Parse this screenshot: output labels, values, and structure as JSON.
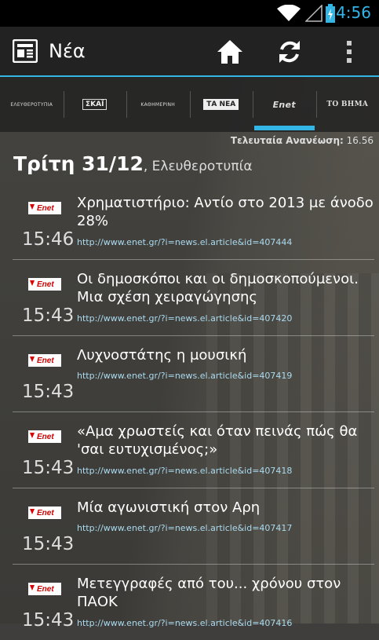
{
  "status_bar": {
    "time": "4:56"
  },
  "action_bar": {
    "title": "Νέα",
    "icons": [
      "newspaper-icon",
      "home-icon",
      "refresh-icon",
      "overflow-menu-icon"
    ]
  },
  "tabs": [
    {
      "label": "ΕΛΕΥΘΕΡΟΤΥΠΙΑ",
      "selected": false
    },
    {
      "label": "ΣΚΑΪ",
      "selected": false
    },
    {
      "label": "ΚΑΘΗΜΕΡΙΝΗ",
      "selected": false
    },
    {
      "label": "ΤΑ ΝΕΑ",
      "selected": false
    },
    {
      "label": "Enet",
      "selected": true
    },
    {
      "label": "ΤΟ ΒΗΜΑ",
      "selected": false
    }
  ],
  "last_update": {
    "label": "Τελευταία Ανανέωση:",
    "value": "16.56"
  },
  "date_header": {
    "day": "Τρίτη 31/12",
    "paper": ", Ελευθεροτυπία"
  },
  "source_logo_text": "Enet",
  "articles": [
    {
      "time": "15:46",
      "title": "Χρηματιστήριο: Αντίο στο 2013 με άνοδο 28%",
      "url": "http://www.enet.gr/?i=news.el.article&id=407444"
    },
    {
      "time": "15:43",
      "title": "Οι δημοσκόποι και οι δημοσκοπούμενοι. Μια σχέση χειραγώγησης",
      "url": "http://www.enet.gr/?i=news.el.article&id=407420"
    },
    {
      "time": "15:43",
      "title": "Λυχνοστάτης η μουσική",
      "url": "http://www.enet.gr/?i=news.el.article&id=407419"
    },
    {
      "time": "15:43",
      "title": "«Αμα χρωστείς και όταν πεινάς πώς θα 'σαι ευτυχισμένος;»",
      "url": "http://www.enet.gr/?i=news.el.article&id=407418"
    },
    {
      "time": "15:43",
      "title": "Μία αγωνιστική στον Αρη",
      "url": "http://www.enet.gr/?i=news.el.article&id=407417"
    },
    {
      "time": "15:43",
      "title": "Μετεγγραφές από του... χρόνου στον ΠΑΟΚ",
      "url": "http://www.enet.gr/?i=news.el.article&id=407416"
    }
  ],
  "colors": {
    "accent": "#33b5e5",
    "actionbar": "#222222",
    "background": "#3f3e3c"
  }
}
